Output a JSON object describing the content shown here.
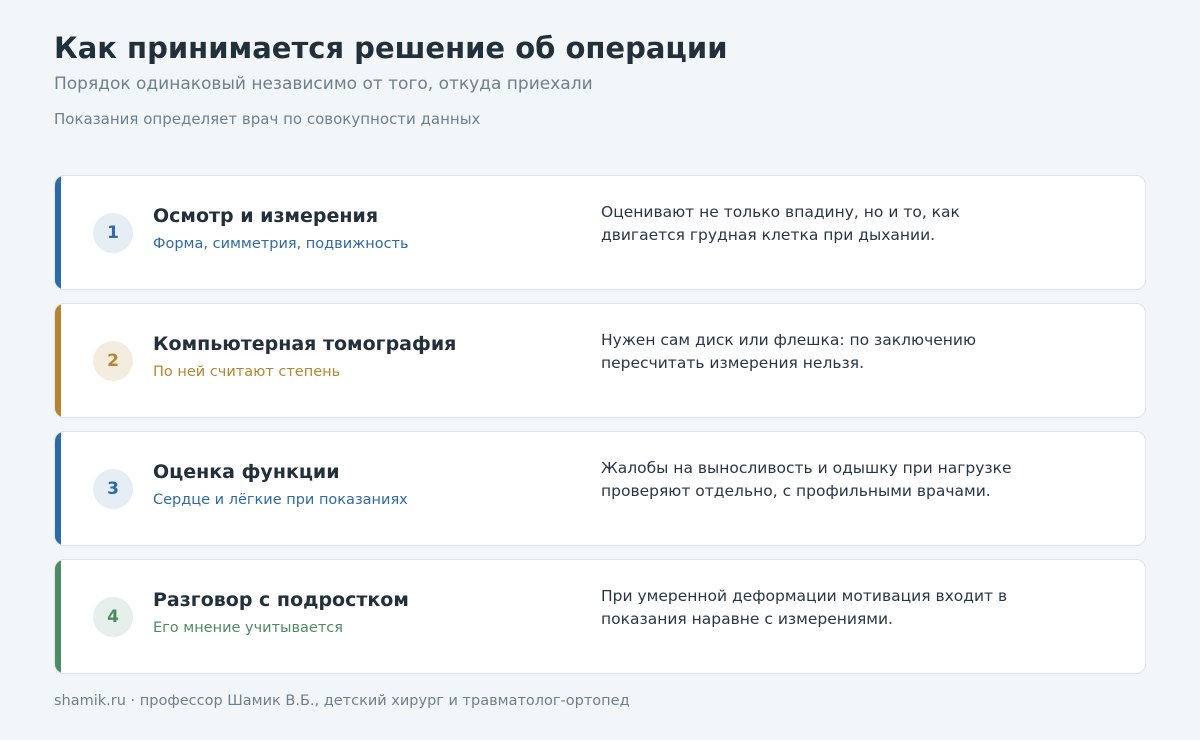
{
  "header": {
    "title": "Как принимается решение об операции",
    "subtitle": "Порядок одинаковый независимо от того, откуда приехали",
    "note": "Показания определяет врач по совокупности данных"
  },
  "steps": [
    {
      "number": "1",
      "title": "Осмотр и измерения",
      "subtitle": "Форма, симметрия, подвижность",
      "description_lines": [
        "Оценивают не только впадину, но и то, как",
        "двигается грудная клетка при дыхании."
      ],
      "accent": "#2f6aa8"
    },
    {
      "number": "2",
      "title": "Компьютерная томография",
      "subtitle": "По ней считают степень",
      "description_lines": [
        "Нужен сам диск или флешка: по заключению",
        "пересчитать измерения нельзя."
      ],
      "accent": "#b68532"
    },
    {
      "number": "3",
      "title": "Оценка функции",
      "subtitle": "Сердце и лёгкие при показаниях",
      "description_lines": [
        "Жалобы на выносливость и одышку при нагрузке",
        "проверяют отдельно, с профильными врачами."
      ],
      "accent": "#2f6aa8"
    },
    {
      "number": "4",
      "title": "Разговор с подростком",
      "subtitle": "Его мнение учитывается",
      "description_lines": [
        "При умеренной деформации мотивация входит в",
        "показания наравне с измерениями."
      ],
      "accent": "#4f8a67"
    }
  ],
  "footer": {
    "text": "shamik.ru · профессор Шамик В.Б., детский хирург и травматолог-ортопед"
  }
}
